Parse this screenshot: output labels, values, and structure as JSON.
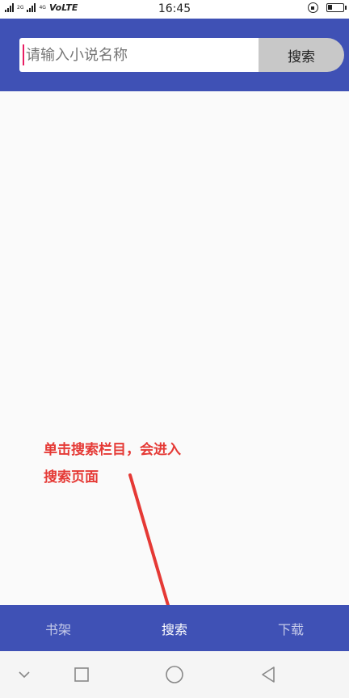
{
  "status_bar": {
    "network_small_top": "2G",
    "network_small_bottom": "4G",
    "volte": "VoLTE",
    "time": "16:45"
  },
  "search": {
    "placeholder": "请输入小说名称",
    "button_label": "搜索"
  },
  "annotation": {
    "line1": "单击搜索栏目，会进入",
    "line2": "搜索页面",
    "color": "#e53935"
  },
  "bottom_nav": {
    "items": [
      {
        "label": "书架",
        "icon": "bookshelf",
        "active": false
      },
      {
        "label": "搜索",
        "icon": "search",
        "active": true
      },
      {
        "label": "下载",
        "icon": "download",
        "active": false
      }
    ]
  },
  "colors": {
    "primary": "#3f51b5",
    "caret": "#e91e63",
    "search_button": "#c8c8c8"
  },
  "system_nav": {
    "icons": [
      "chevron-down-icon",
      "square-icon",
      "circle-icon",
      "triangle-left-icon"
    ]
  }
}
